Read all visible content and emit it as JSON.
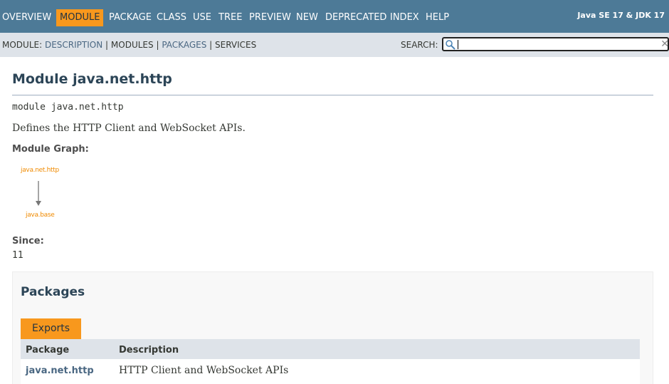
{
  "topnav": {
    "items": [
      "OVERVIEW",
      "MODULE",
      "PACKAGE",
      "CLASS",
      "USE",
      "TREE",
      "PREVIEW",
      "NEW",
      "DEPRECATED",
      "INDEX",
      "HELP"
    ],
    "active": "MODULE",
    "about": "Java SE 17 & JDK 17"
  },
  "subnav": {
    "prefix": "MODULE:",
    "links": [
      "DESCRIPTION",
      "MODULES",
      "PACKAGES",
      "SERVICES"
    ],
    "search_label": "SEARCH:",
    "search_value": ""
  },
  "header": {
    "title": "Module java.net.http",
    "signature": "module java.net.http",
    "description": "Defines the HTTP Client and WebSocket APIs."
  },
  "module_graph": {
    "label": "Module Graph:",
    "nodes": [
      "java.net.http",
      "java.base"
    ]
  },
  "since": {
    "label": "Since:",
    "value": "11"
  },
  "packages": {
    "title": "Packages",
    "tab": "Exports",
    "columns": [
      "Package",
      "Description"
    ],
    "rows": [
      {
        "package": "java.net.http",
        "description": "HTTP Client and WebSocket APIs"
      }
    ]
  },
  "colors": {
    "nav_bg": "#4d7a97",
    "accent": "#f8981d",
    "subnav_bg": "#dee3e9",
    "link": "#4a6782"
  }
}
